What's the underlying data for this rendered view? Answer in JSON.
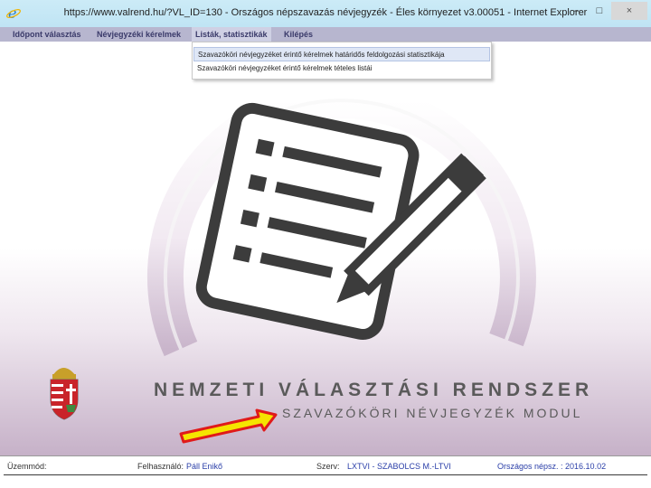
{
  "window": {
    "title": "https://www.valrend.hu/?VL_ID=130 - Országos népszavazás névjegyzék - Éles környezet v3.00051 - Internet Explorer",
    "minimize_label": "–",
    "maximize_label": "□",
    "close_label": "×"
  },
  "menu": {
    "items": [
      {
        "label": "Időpont választás"
      },
      {
        "label": "Névjegyzéki kérelmek"
      },
      {
        "label": "Listák, statisztikák"
      },
      {
        "label": "Kilépés"
      }
    ]
  },
  "dropdown": {
    "items": [
      {
        "label": "Szavazóköri névjegyzéket érintő kérelmek határidős feldolgozási statisztikája"
      },
      {
        "label": "Szavazóköri névjegyzéket érintő kérelmek tételes listái"
      }
    ]
  },
  "branding": {
    "title": "NEMZETI VÁLASZTÁSI RENDSZER",
    "subtitle": "SZAVAZÓKÖRI NÉVJEGYZÉK MODUL"
  },
  "statusbar": {
    "mode_label": "Üzemmód:",
    "user_label": "Felhasználó:",
    "user_value": "Páll Enikő",
    "org_label": "Szerv:",
    "org_value": "LXTVI - SZABOLCS M.-LTVI",
    "election_value": "Országos népsz. : 2016.10.02"
  },
  "colors": {
    "menubar": "#b7b6cf",
    "menu_text": "#3a3a6a",
    "arrow_fill": "#f5e400",
    "arrow_stroke": "#e01a1a",
    "status_value": "#2a3ea8",
    "arc_gradient_end": "#c6b1c8"
  },
  "icons": {
    "browser": "internet-explorer-icon",
    "illustration": "checklist-with-pencil-icon",
    "emblem": "hungarian-coat-of-arms-icon",
    "pointer": "yellow-arrow-icon"
  }
}
